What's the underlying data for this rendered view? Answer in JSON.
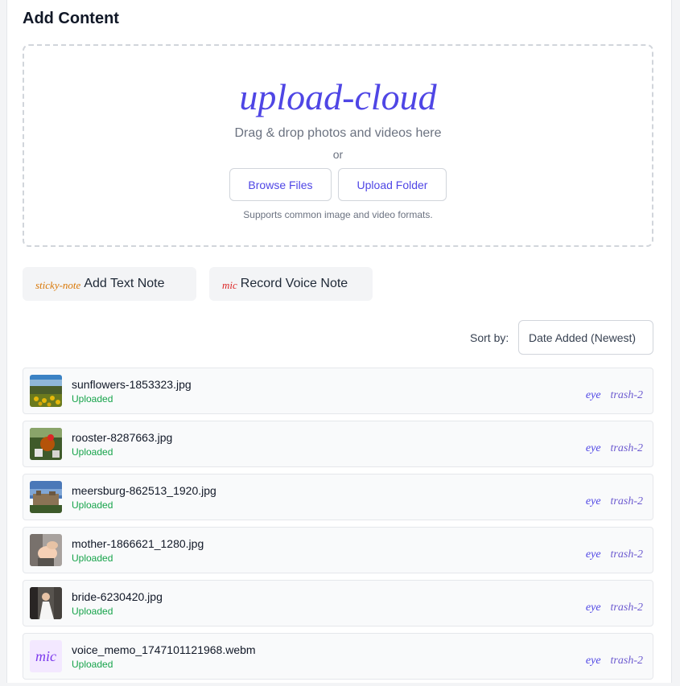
{
  "header": {
    "title": "Add Content"
  },
  "dropzone": {
    "icon": "upload-cloud",
    "main_text": "Drag & drop photos and videos here",
    "or_text": "or",
    "browse_label": "Browse Files",
    "folder_label": "Upload Folder",
    "supports_text": "Supports common image and video formats."
  },
  "notes": {
    "text_icon": "sticky-note",
    "text_label": "Add Text Note",
    "voice_icon": "mic",
    "voice_label": "Record Voice Note"
  },
  "sort": {
    "label": "Sort by:",
    "selected": "Date Added (Newest)"
  },
  "files": [
    {
      "name": "sunflowers-1853323.jpg",
      "status": "Uploaded",
      "view_icon": "eye",
      "delete_icon": "trash-2",
      "thumb": "sunflowers"
    },
    {
      "name": "rooster-8287663.jpg",
      "status": "Uploaded",
      "view_icon": "eye",
      "delete_icon": "trash-2",
      "thumb": "rooster"
    },
    {
      "name": "meersburg-862513_1920.jpg",
      "status": "Uploaded",
      "view_icon": "eye",
      "delete_icon": "trash-2",
      "thumb": "meersburg"
    },
    {
      "name": "mother-1866621_1280.jpg",
      "status": "Uploaded",
      "view_icon": "eye",
      "delete_icon": "trash-2",
      "thumb": "mother"
    },
    {
      "name": "bride-6230420.jpg",
      "status": "Uploaded",
      "view_icon": "eye",
      "delete_icon": "trash-2",
      "thumb": "bride"
    },
    {
      "name": "voice_memo_1747101121968.webm",
      "status": "Uploaded",
      "view_icon": "eye",
      "delete_icon": "trash-2",
      "thumb_icon": "mic"
    }
  ]
}
